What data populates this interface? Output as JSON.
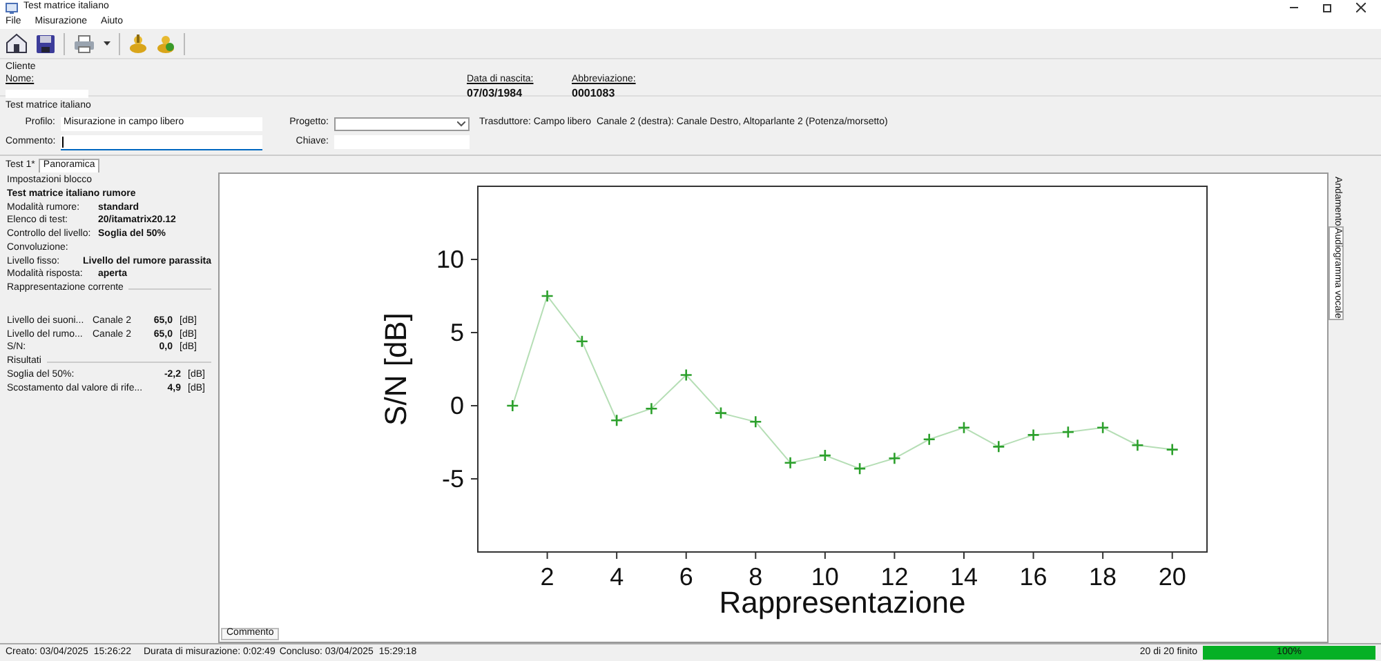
{
  "window": {
    "title": "Test matrice italiano"
  },
  "menu": [
    "File",
    "Misurazione",
    "Aiuto"
  ],
  "client": {
    "heading": "Cliente",
    "fields": [
      {
        "label": "Nome:",
        "redacted": true
      },
      {
        "label": "Data di nascita:",
        "value": "07/03/1984",
        "redacted": false
      },
      {
        "label": "Abbreviazione:",
        "value": "0001083",
        "redacted": false
      }
    ]
  },
  "test": {
    "heading": "Test matrice italiano",
    "profile": {
      "label": "Profilo:",
      "value": "Misurazione in campo libero"
    },
    "project": {
      "label": "Progetto:"
    },
    "transducer": "Trasduttore: Campo libero  Canale 2 (destra): Canale Destro, Altoparlante 2 (Potenza/morsetto)",
    "comment": {
      "label": "Commento:",
      "focused": true
    },
    "key": {
      "label": "Chiave:"
    }
  },
  "tabs": [
    {
      "label": "Test 1*",
      "selected": true
    },
    {
      "label": "Panoramica",
      "selected": false
    }
  ],
  "block": {
    "heading": "Impostazioni blocco",
    "title": "Test matrice italiano rumore",
    "rows": [
      {
        "label": "Modalità rumore:",
        "value": "standard"
      },
      {
        "label": "Elenco di test:",
        "value": "20/itamatrix20.12"
      },
      {
        "label": "Controllo del livello:",
        "value": "Soglia del 50%"
      },
      {
        "label": "Convoluzione:",
        "value": ""
      },
      {
        "label": "Livello fisso:",
        "value": "Livello del rumore parassita"
      },
      {
        "label": "Modalità risposta:",
        "value": "aperta"
      }
    ]
  },
  "current": {
    "heading": "Rappresentazione corrente",
    "rows": [
      {
        "label": "Livello dei suoni...",
        "channel": "Canale 2",
        "value": "65,0",
        "unit": "[dB]"
      },
      {
        "label": "Livello del rumo...",
        "channel": "Canale 2",
        "value": "65,0",
        "unit": "[dB]"
      },
      {
        "label": "S/N:",
        "channel": "",
        "value": "0,0",
        "unit": "[dB]"
      }
    ]
  },
  "results": {
    "heading": "Risultati",
    "rows": [
      {
        "label": "Soglia del 50%:",
        "value": "-2,2",
        "unit": "[dB]"
      },
      {
        "label": "Scostamento dal valore di rife...",
        "value": "4,9",
        "unit": "[dB]"
      }
    ]
  },
  "chart": {
    "chart_data": {
      "type": "line",
      "xlabel": "Rappresentazione",
      "ylabel": "S/N [dB]",
      "x": [
        1,
        2,
        3,
        4,
        5,
        6,
        7,
        8,
        9,
        10,
        11,
        12,
        13,
        14,
        15,
        16,
        17,
        18,
        19,
        20
      ],
      "series": [
        {
          "color": "#2ca02c",
          "marker": "+",
          "values": [
            0,
            7.5,
            4.4,
            -1,
            -0.2,
            2.1,
            -0.5,
            -1.1,
            -3.9,
            -3.4,
            -4.3,
            -3.6,
            -2.3,
            -1.5,
            -2.8,
            -2,
            -1.8,
            -1.5,
            -2.7,
            -3
          ]
        }
      ],
      "xlim": [
        0,
        21
      ],
      "ylim": [
        -10,
        15
      ],
      "xticks": [
        2,
        4,
        6,
        8,
        10,
        12,
        14,
        16,
        18,
        20
      ],
      "yticks": [
        -5,
        0,
        5,
        10
      ]
    },
    "comment_button": "Commento"
  },
  "side_tabs": [
    {
      "label": "Andamento",
      "selected": true
    },
    {
      "label": "Audiogramma vocale",
      "selected": false
    }
  ],
  "status": {
    "created": "Creato: 03/04/2025  15:26:22",
    "duration": "Durata di misurazione: 0:02:49",
    "finished": "Concluso: 03/04/2025  15:29:18",
    "count": "20 di 20 finito",
    "progress_text": "100%",
    "level": 1
  }
}
